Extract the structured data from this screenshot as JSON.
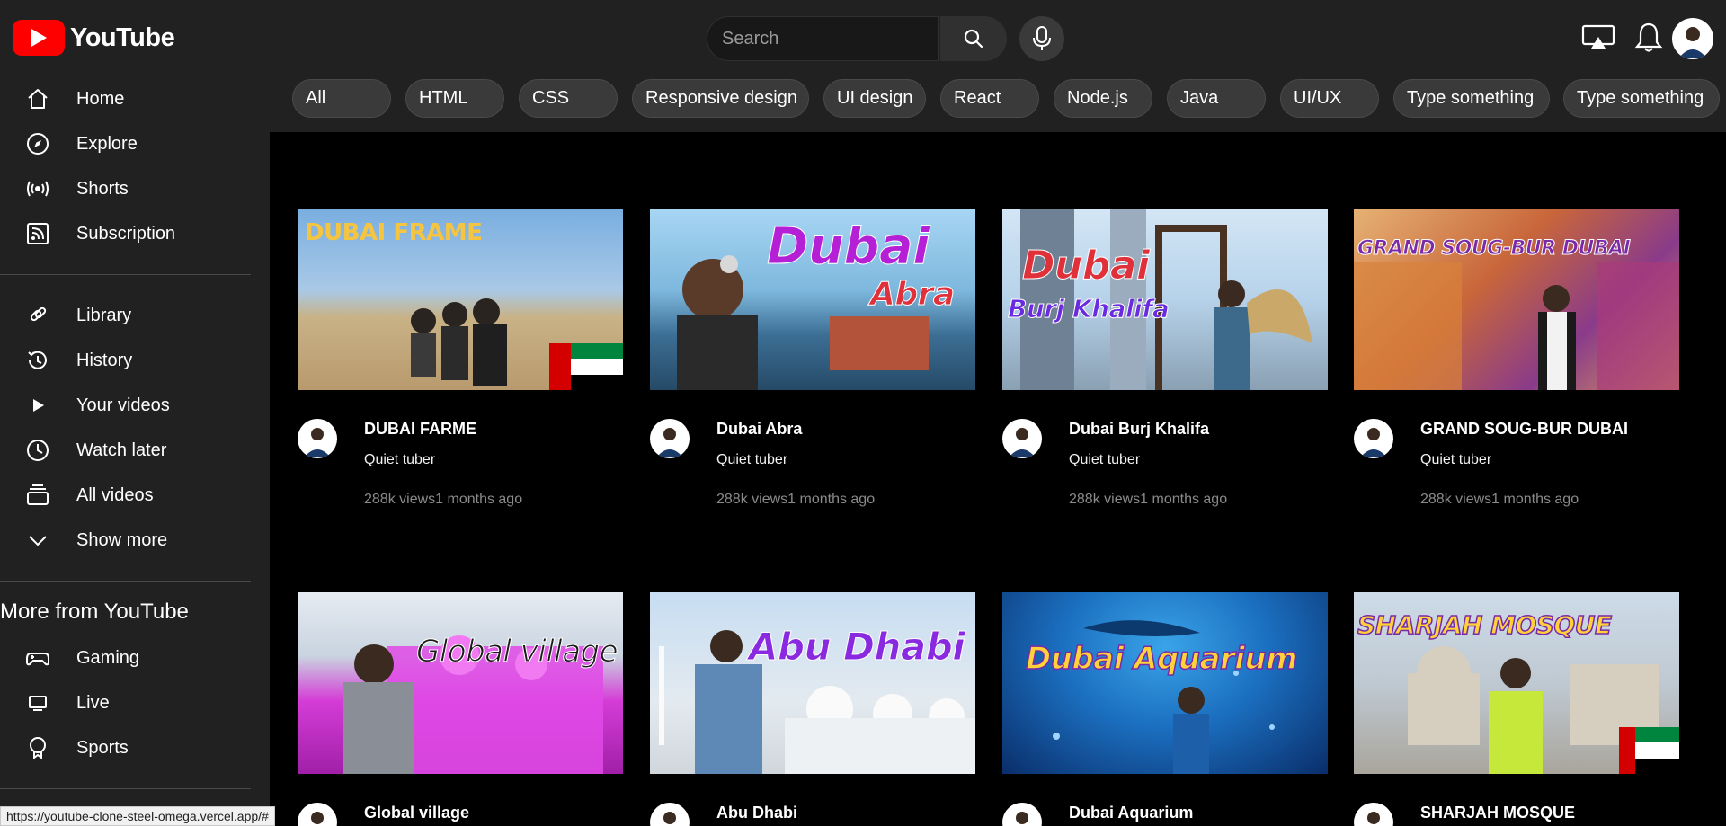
{
  "header": {
    "logo_text": "YouTube",
    "search_placeholder": "Search"
  },
  "sidebar": {
    "main": [
      {
        "label": "Home",
        "icon": "home-icon"
      },
      {
        "label": "Explore",
        "icon": "compass-icon"
      },
      {
        "label": "Shorts",
        "icon": "broadcast-icon"
      },
      {
        "label": "Subscription",
        "icon": "rss-icon"
      }
    ],
    "library": [
      {
        "label": "Library",
        "icon": "link-icon"
      },
      {
        "label": "History",
        "icon": "history-icon"
      },
      {
        "label": "Your videos",
        "icon": "play-icon"
      },
      {
        "label": "Watch later",
        "icon": "clock-icon"
      },
      {
        "label": "All videos",
        "icon": "stack-icon"
      },
      {
        "label": "Show more",
        "icon": "chevron-down-icon"
      }
    ],
    "more_title": "More from YouTube",
    "more": [
      {
        "label": "Gaming",
        "icon": "gamepad-icon"
      },
      {
        "label": "Live",
        "icon": "monitor-icon"
      },
      {
        "label": "Sports",
        "icon": "trophy-icon"
      }
    ]
  },
  "chips": [
    "All",
    "HTML",
    "CSS",
    "Responsive design",
    "UI design",
    "React",
    "Node.js",
    "Java",
    "UI/UX",
    "Type something",
    "Type something"
  ],
  "videos": [
    {
      "title": "DUBAI FARME",
      "thumb_text": "DUBAI FRAME",
      "channel": "Quiet tuber",
      "stats": "288k views1 months ago",
      "thumb_colors": [
        "#6fa3d8",
        "#c9b48a"
      ],
      "text_color": "#f5c542"
    },
    {
      "title": "Dubai Abra",
      "thumb_text": "Dubai",
      "thumb_text2": "Abra",
      "channel": "Quiet tuber",
      "stats": "288k views1 months ago",
      "thumb_colors": [
        "#9fd0f0",
        "#2f5d80"
      ],
      "text_color": "#b51fd6"
    },
    {
      "title": "Dubai Burj Khalifa",
      "thumb_text": "Dubai",
      "thumb_text2": "Burj Khalifa",
      "channel": "Quiet tuber",
      "stats": "288k views1 months ago",
      "thumb_colors": [
        "#bcd8ef",
        "#7a8a9a"
      ],
      "text_color": "#e0303a"
    },
    {
      "title": "GRAND SOUG-BUR DUBAI",
      "thumb_text": "GRAND SOUG-BUR DUBAI",
      "channel": "Quiet tuber",
      "stats": "288k views1 months ago",
      "thumb_colors": [
        "#d9a46a",
        "#b65a3a"
      ],
      "text_color": "#7a2aa8"
    },
    {
      "title": "Global village",
      "thumb_text": "Global village",
      "channel": "",
      "stats": "",
      "thumb_colors": [
        "#d9e3ee",
        "#d43cd6"
      ],
      "text_color": "#1a1a1a"
    },
    {
      "title": "Abu Dhabi",
      "thumb_text": "Abu Dhabi",
      "channel": "",
      "stats": "",
      "thumb_colors": [
        "#cfe2f5",
        "#e6ebf0"
      ],
      "text_color": "#8a2ae0"
    },
    {
      "title": "Dubai Aquarium",
      "thumb_text": "Dubai Aquarium",
      "channel": "",
      "stats": "",
      "thumb_colors": [
        "#1b6fc0",
        "#0a2e6a"
      ],
      "text_color": "#ffd23a"
    },
    {
      "title": "SHARJAH MOSQUE",
      "thumb_text": "SHARJAH MOSQUE",
      "channel": "",
      "stats": "",
      "thumb_colors": [
        "#c7d6e4",
        "#b9b4ab"
      ],
      "text_color": "#ffd23a"
    }
  ],
  "status_url": "https://youtube-clone-steel-omega.vercel.app/#"
}
